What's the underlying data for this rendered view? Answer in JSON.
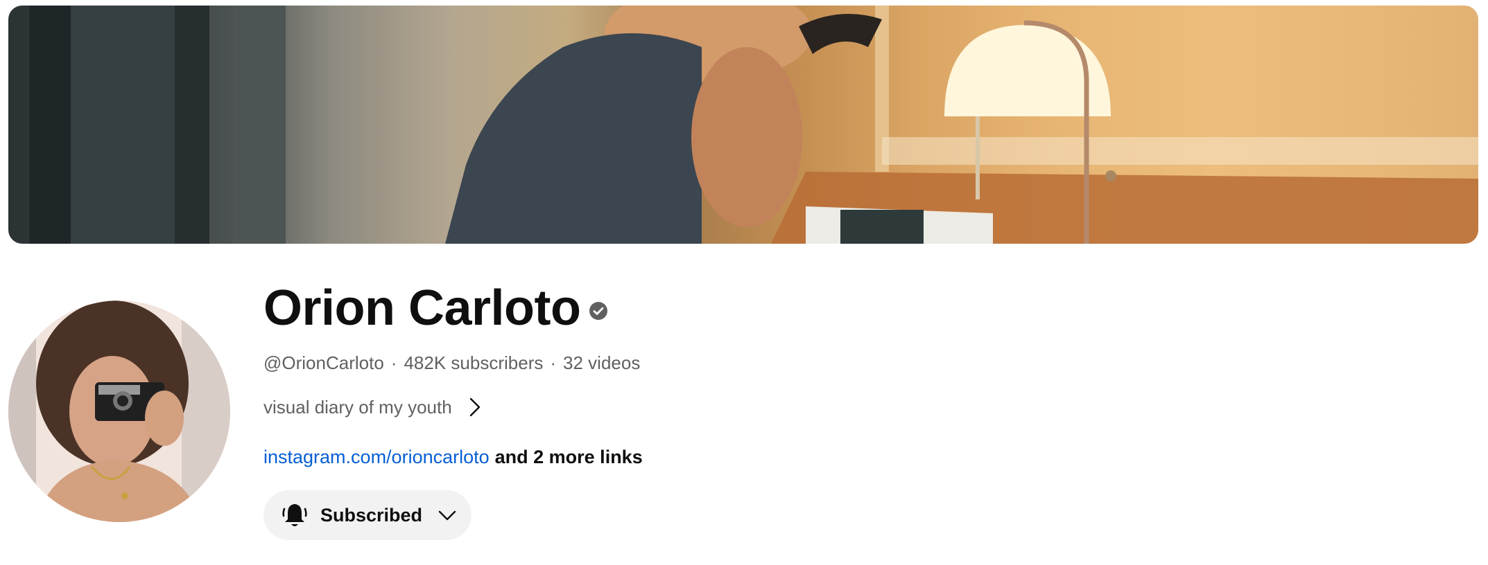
{
  "channel": {
    "name": "Orion Carloto",
    "verified": true,
    "handle": "@OrionCarloto",
    "separator": "·",
    "subscribers": "482K subscribers",
    "videos": "32 videos",
    "description": "visual diary of my youth",
    "link": "instagram.com/orioncarloto",
    "more_links": "and 2 more links"
  },
  "subscribe_button": {
    "label": "Subscribed"
  },
  "icons": {
    "verified": "verified-check-icon",
    "description_more": "chevron-right-icon",
    "bell": "bell-icon",
    "dropdown": "chevron-down-icon"
  },
  "colors": {
    "link": "#065fd4",
    "secondary_text": "#606060",
    "button_bg": "#f2f2f2"
  }
}
